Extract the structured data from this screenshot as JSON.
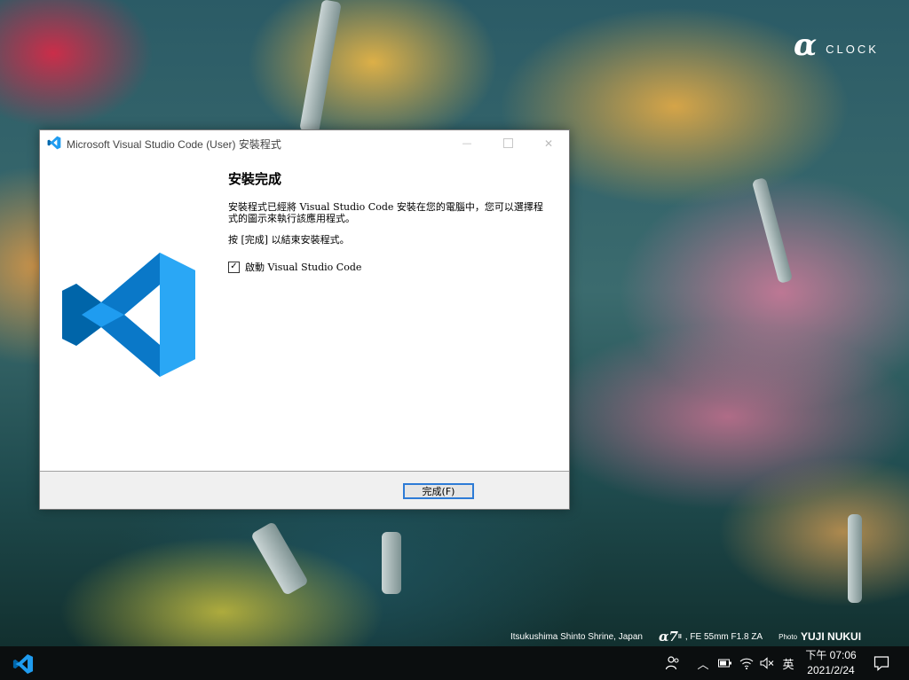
{
  "wallpaper": {
    "brand_symbol": "α",
    "brand_text": "CLOCK",
    "location": "Itsukushima Shinto Shrine, Japan",
    "camera": "α7",
    "camera_suffix": "II",
    "lens": ", FE 55mm F1.8 ZA",
    "photo_label": "Photo",
    "author": "YUJI NUKUI"
  },
  "window": {
    "title": "Microsoft Visual Studio Code (User) 安裝程式",
    "heading": "安裝完成",
    "paragraph": "安裝程式已經將 Visual Studio Code 安裝在您的電腦中，您可以選擇程式的圖示來執行該應用程式。",
    "instruction": "按 [完成] 以結束安裝程式。",
    "checkbox": {
      "label": "啟動 Visual Studio Code",
      "checked": true,
      "mark": "✓"
    },
    "finish_label": "完成(F)",
    "controls": {
      "minimize": "—",
      "close": "✕"
    }
  },
  "taskbar": {
    "ime": "英",
    "time": "下午 07:06",
    "date": "2021/2/24",
    "chevron": "︿"
  },
  "colors": {
    "vscode_blue": "#1f9cf0",
    "vscode_dark": "#0065a9",
    "accent": "#2d7bd6"
  }
}
